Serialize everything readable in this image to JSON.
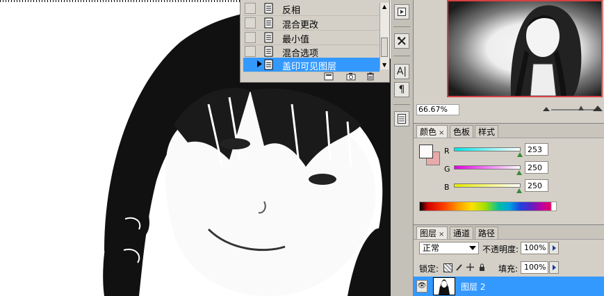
{
  "history": {
    "items": [
      {
        "label": "反相",
        "active": false
      },
      {
        "label": "混合更改",
        "active": false
      },
      {
        "label": "最小值",
        "active": false
      },
      {
        "label": "混合选项",
        "active": false
      },
      {
        "label": "盖印可见图层",
        "active": true
      }
    ]
  },
  "navigator": {
    "zoom": "66.67%"
  },
  "color_panel": {
    "tabs": [
      "颜色",
      "色板",
      "样式"
    ],
    "close_glyph": "×",
    "channels": [
      {
        "label": "R",
        "value": "253",
        "fraction": 0.992
      },
      {
        "label": "G",
        "value": "250",
        "fraction": 0.98
      },
      {
        "label": "B",
        "value": "250",
        "fraction": 0.98
      }
    ],
    "foreground_color": "#fdfafa",
    "background_color": "#e8a9a9"
  },
  "layers_panel": {
    "tabs": [
      "图层",
      "通道",
      "路径"
    ],
    "close_glyph": "×",
    "blend_mode": "正常",
    "opacity_label": "不透明度:",
    "opacity_value": "100%",
    "lock_label": "锁定:",
    "fill_label": "填充:",
    "fill_value": "100%",
    "layers": [
      {
        "name": "图层 2",
        "selected": true
      }
    ]
  },
  "strip": {
    "icons": [
      "play-icon",
      "tools-icon",
      "character-icon",
      "paragraph-icon",
      "notes-icon"
    ],
    "glyphs": {
      "character": "A|",
      "paragraph": "¶"
    }
  },
  "colors": {
    "selection": "#3399ff",
    "panel_bg": "#d4d0c8",
    "nav_frame": "#d84040"
  }
}
